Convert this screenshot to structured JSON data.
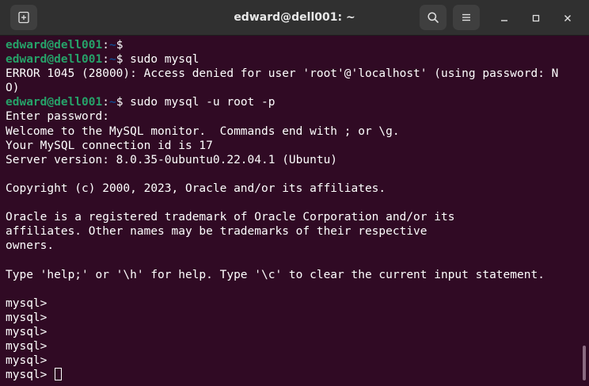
{
  "window": {
    "title": "edward@dell001: ~"
  },
  "icons": {
    "new_tab": "new-tab-icon",
    "search": "search-icon",
    "menu": "hamburger-menu-icon",
    "minimize": "minimize-icon",
    "maximize": "maximize-icon",
    "close": "close-icon"
  },
  "colors": {
    "terminal_bg": "#300a24",
    "prompt_user": "#26a269",
    "prompt_path": "#12488b",
    "text": "#ffffff",
    "titlebar_bg": "#303030"
  },
  "terminal": {
    "lines": [
      {
        "user": "edward@dell001",
        "sep": ":",
        "path": "~",
        "prompt": "$ ",
        "text": ""
      },
      {
        "user": "edward@dell001",
        "sep": ":",
        "path": "~",
        "prompt": "$ ",
        "text": "sudo mysql"
      },
      {
        "text": "ERROR 1045 (28000): Access denied for user 'root'@'localhost' (using password: N"
      },
      {
        "text": "O)"
      },
      {
        "user": "edward@dell001",
        "sep": ":",
        "path": "~",
        "prompt": "$ ",
        "text": "sudo mysql -u root -p"
      },
      {
        "text": "Enter password: "
      },
      {
        "text": "Welcome to the MySQL monitor.  Commands end with ; or \\g."
      },
      {
        "text": "Your MySQL connection id is 17"
      },
      {
        "text": "Server version: 8.0.35-0ubuntu0.22.04.1 (Ubuntu)"
      },
      {
        "text": ""
      },
      {
        "text": "Copyright (c) 2000, 2023, Oracle and/or its affiliates."
      },
      {
        "text": ""
      },
      {
        "text": "Oracle is a registered trademark of Oracle Corporation and/or its"
      },
      {
        "text": "affiliates. Other names may be trademarks of their respective"
      },
      {
        "text": "owners."
      },
      {
        "text": ""
      },
      {
        "text": "Type 'help;' or '\\h' for help. Type '\\c' to clear the current input statement."
      },
      {
        "text": ""
      },
      {
        "text": "mysql> "
      },
      {
        "text": "mysql> "
      },
      {
        "text": "mysql> "
      },
      {
        "text": "mysql> "
      },
      {
        "text": "mysql> "
      },
      {
        "text": "mysql> ",
        "cursor": true
      }
    ]
  }
}
